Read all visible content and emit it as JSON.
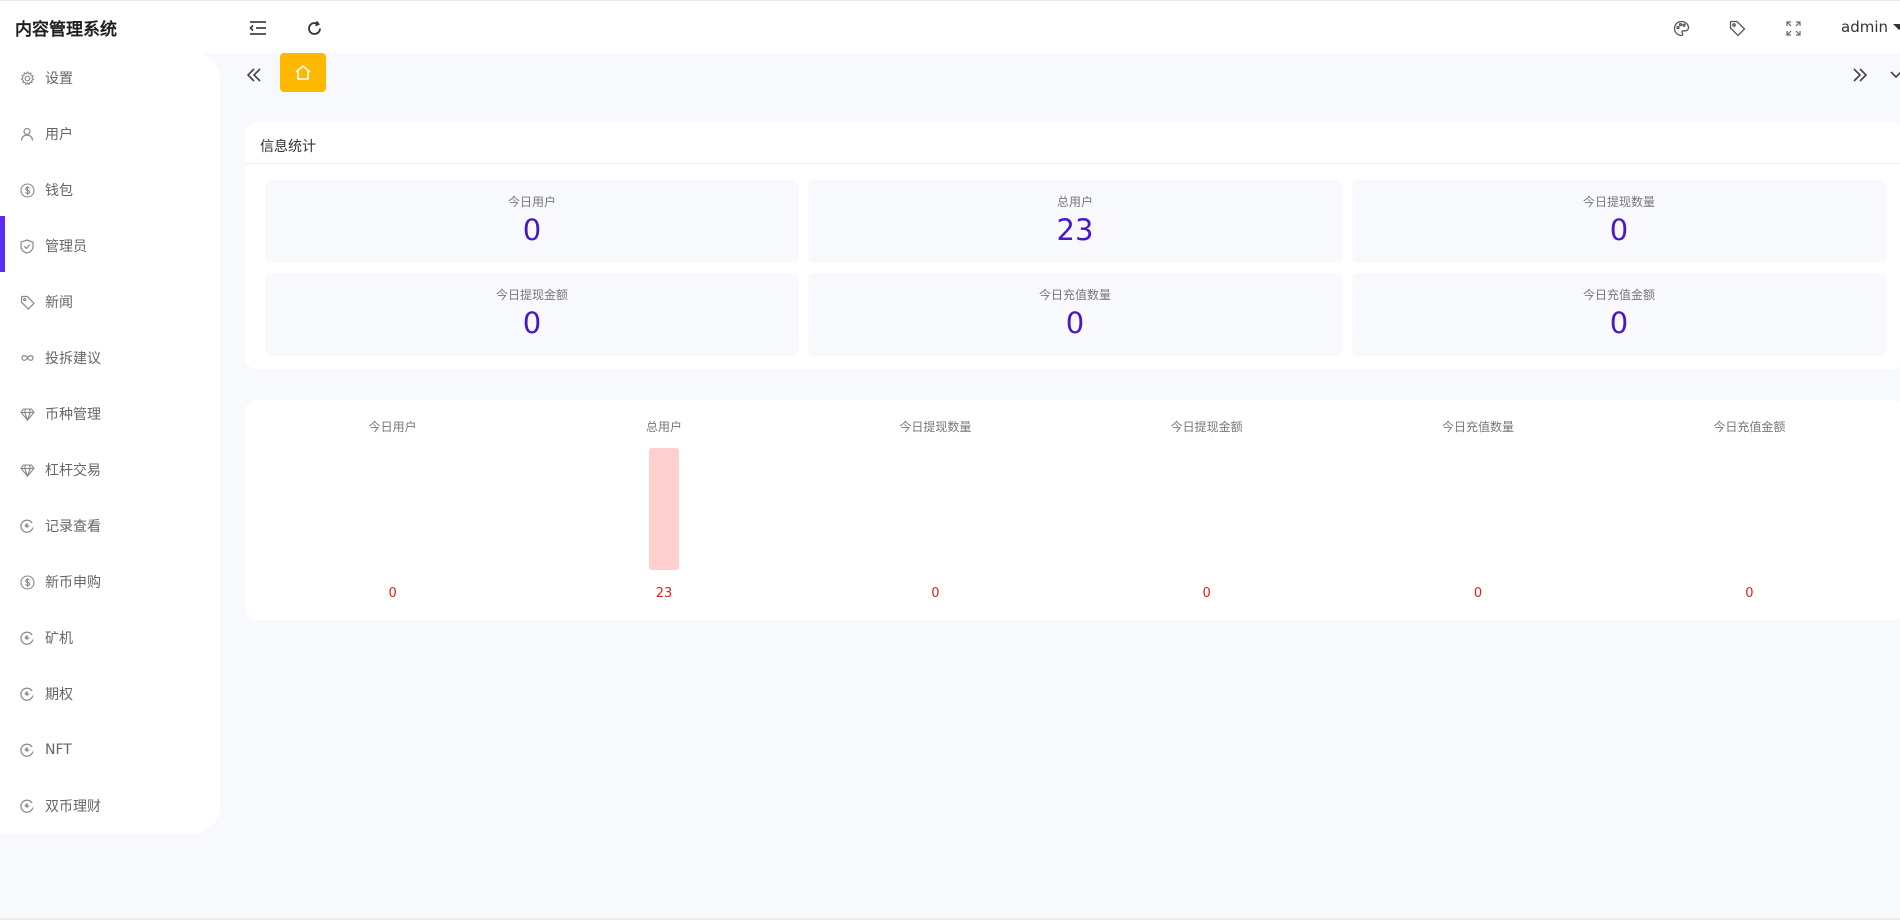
{
  "app": {
    "title": "内容管理系统"
  },
  "header": {
    "user_name": "admin"
  },
  "sidebar": {
    "items": [
      {
        "label": "设置",
        "icon": "gear-icon"
      },
      {
        "label": "用户",
        "icon": "user-icon"
      },
      {
        "label": "钱包",
        "icon": "dollar-icon",
        "active": true
      },
      {
        "label": "管理员",
        "icon": "shield-icon"
      },
      {
        "label": "新闻",
        "icon": "tag-icon"
      },
      {
        "label": "投拆建议",
        "icon": "infinity-icon"
      },
      {
        "label": "币种管理",
        "icon": "diamond-icon"
      },
      {
        "label": "杠杆交易",
        "icon": "diamond-icon"
      },
      {
        "label": "记录查看",
        "icon": "circle-arrow-icon"
      },
      {
        "label": "新币申购",
        "icon": "dollar-icon"
      },
      {
        "label": "矿机",
        "icon": "circle-arrow-icon"
      },
      {
        "label": "期权",
        "icon": "circle-arrow-icon"
      },
      {
        "label": "NFT",
        "icon": "circle-arrow-icon"
      },
      {
        "label": "双币理财",
        "icon": "circle-arrow-icon"
      }
    ]
  },
  "stats": {
    "title": "信息统计",
    "items": [
      {
        "label": "今日用户",
        "value": "0"
      },
      {
        "label": "总用户",
        "value": "23"
      },
      {
        "label": "今日提现数量",
        "value": "0"
      },
      {
        "label": "今日提现金额",
        "value": "0"
      },
      {
        "label": "今日充值数量",
        "value": "0"
      },
      {
        "label": "今日充值金额",
        "value": "0"
      }
    ]
  },
  "colors": {
    "accent": "#5b2cf5",
    "value_text": "#4b16c9",
    "home_tab": "#ffb800",
    "bar": "#ffcfd0",
    "bar_label": "#e02020"
  },
  "chart_data": {
    "type": "bar",
    "categories": [
      "今日用户",
      "总用户",
      "今日提现数量",
      "今日提现金额",
      "今日充值数量",
      "今日充值金额"
    ],
    "values": [
      0,
      23,
      0,
      0,
      0,
      0
    ],
    "title": "",
    "xlabel": "",
    "ylabel": "",
    "ylim": [
      0,
      23
    ],
    "grid": false
  }
}
